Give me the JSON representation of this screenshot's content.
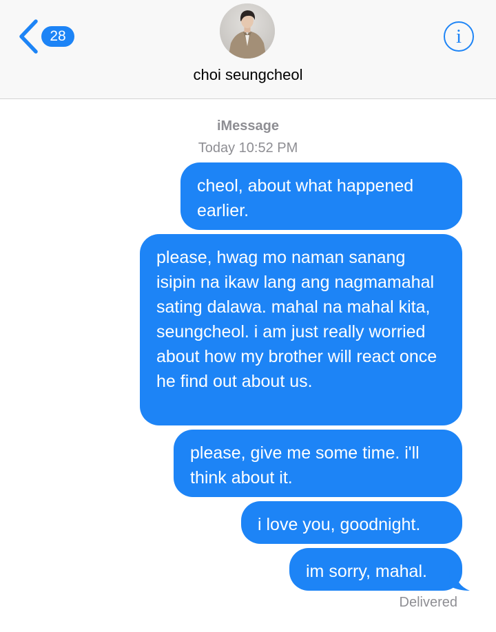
{
  "header": {
    "back_icon": "chevron-left-icon",
    "unread_count": "28",
    "avatar": "contact-photo",
    "contact_name": "choi seungcheol",
    "info_icon_glyph": "i",
    "info_icon": "info-circle-icon"
  },
  "conversation": {
    "service": "iMessage",
    "timestamp": "Today 10:52 PM",
    "messages": [
      {
        "direction": "outgoing",
        "text": "cheol, about what happened earlier."
      },
      {
        "direction": "outgoing",
        "text": "please, hwag mo naman sanang isipin na ikaw lang ang nagmamahal sating dalawa. mahal na mahal kita, seungcheol. i am just really worried about how my brother will react once he find out about us."
      },
      {
        "direction": "outgoing",
        "text": "please, give me some time. i'll think about it."
      },
      {
        "direction": "outgoing",
        "text": "i love you, goodnight."
      },
      {
        "direction": "outgoing",
        "text": "im sorry, mahal."
      }
    ],
    "status": "Delivered"
  },
  "colors": {
    "accent": "#1d84f6",
    "header_background": "#f8f8f8",
    "meta_text": "#8e8e93",
    "bubble_text": "#ffffff"
  }
}
